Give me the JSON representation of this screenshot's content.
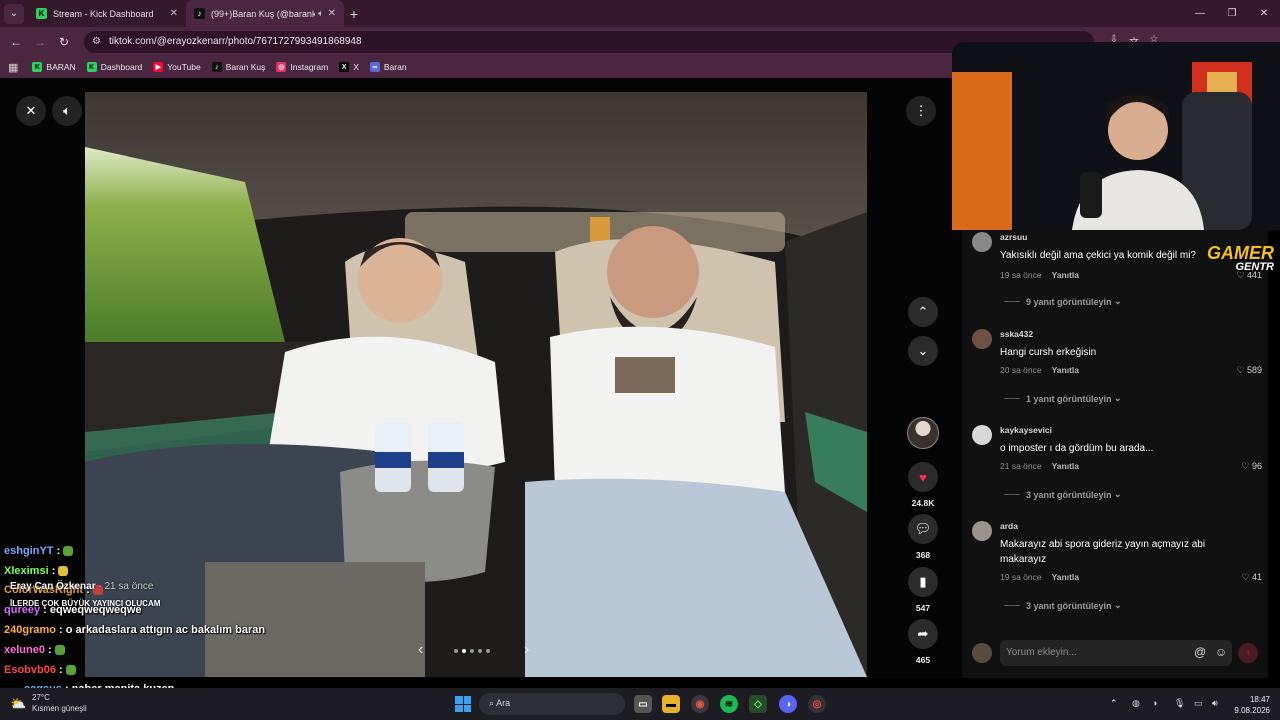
{
  "browser": {
    "tabs": [
      {
        "title": "Stream - Kick Dashboard",
        "favicon": "kick-icon",
        "active": false
      },
      {
        "title": "(99+)Baran Kuş (@barankus",
        "favicon": "tiktok-icon",
        "active": true
      }
    ],
    "url": "tiktok.com/@erayozkenarr/photo/7671727993491868948",
    "bookmarks": [
      {
        "label": "BARAN",
        "icon": "kick-icon"
      },
      {
        "label": "Dashboard",
        "icon": "kick-icon"
      },
      {
        "label": "YouTube",
        "icon": "youtube-icon"
      },
      {
        "label": "Baran Kuş",
        "icon": "tiktok-icon"
      },
      {
        "label": "Instagram",
        "icon": "instagram-icon"
      },
      {
        "label": "X",
        "icon": "x-icon"
      },
      {
        "label": "Baran",
        "icon": "link-icon"
      }
    ]
  },
  "post": {
    "likes": "24.8K",
    "comments": "368",
    "saves": "547",
    "shares": "465",
    "carousel_active_index": 1,
    "carousel_count": 5
  },
  "comments": [
    {
      "user": "azrsuu",
      "text": "Yakısıklı değil ama çekici ya komik değil mi?",
      "time": "19 sa önce",
      "reply": "Yanıtla",
      "likes": "441",
      "replies": "9 yanıt görüntüleyin"
    },
    {
      "user": "sska432",
      "text": "Hangi cursh erkeğisin",
      "time": "20 sa önce",
      "reply": "Yanıtla",
      "likes": "589",
      "replies": "1 yanıt görüntüleyin"
    },
    {
      "user": "kaykaysevici",
      "text": "o imposter ı da gördüm bu arada...",
      "time": "21 sa önce",
      "reply": "Yanıtla",
      "likes": "96",
      "replies": "3 yanıt görüntüleyin"
    },
    {
      "user": "arda",
      "text": "Makarayız abi spora gideriz yayın açmayız abi makarayız",
      "time": "19 sa önce",
      "reply": "Yanıtla",
      "likes": "41",
      "replies": "3 yanıt görüntüleyin"
    }
  ],
  "comment_input": {
    "placeholder": "Yorum ekleyin..."
  },
  "stream_overlay": {
    "logo_line1": "GAMER",
    "logo_line2": "GENTR",
    "tiktok_user": "Eray Can Özkenar",
    "tiktok_time": "· 21 sa önce",
    "tiktok_caption": "İLERDE ÇOK BÜYÜK YAYINCI OLUCAM"
  },
  "chat": [
    {
      "user": "eshginYT",
      "msg": "",
      "color": "#7fa8ff"
    },
    {
      "user": "Xleximsi",
      "msg": "",
      "color": "#7dff5a"
    },
    {
      "user": "ColorWasRight",
      "msg": "",
      "color": "#e8a23a"
    },
    {
      "user": "qureey",
      "msg": "eqweqweqweqwe",
      "color": "#d86cff"
    },
    {
      "user": "240gramo",
      "msg": "o arkadaslara attıgın ac bakalım baran",
      "color": "#ffb13b"
    },
    {
      "user": "xelune0",
      "msg": "",
      "color": "#ff6fe0"
    },
    {
      "user": "Esobvb06",
      "msg": "",
      "color": "#ff4a4a"
    },
    {
      "user": "cageus",
      "msg": "naber manita kuzen",
      "color": "#6ab7ff"
    }
  ],
  "taskbar": {
    "temp": "27°C",
    "weather": "Kısmen güneşli",
    "search": "Ara",
    "time": "18:47",
    "date": "9.08.2026"
  }
}
